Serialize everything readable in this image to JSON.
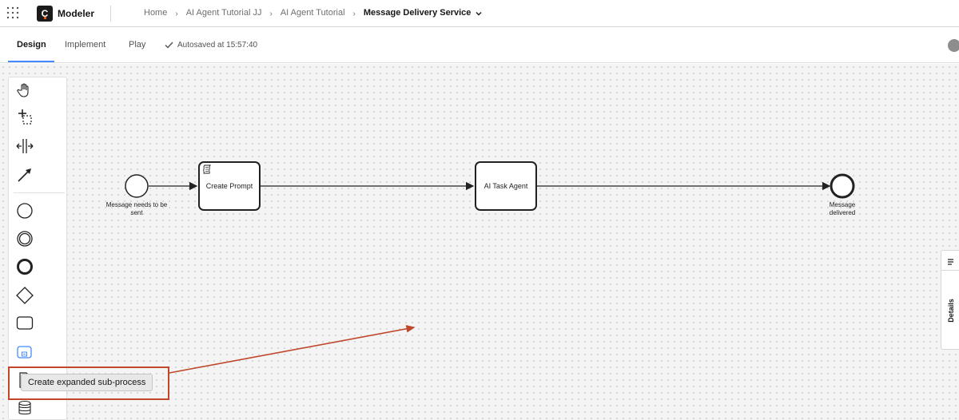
{
  "header": {
    "app_logo_letter": "C",
    "app_name": "Modeler",
    "breadcrumb": [
      "Home",
      "AI Agent Tutorial JJ",
      "AI Agent Tutorial"
    ],
    "breadcrumb_current": "Message Delivery Service"
  },
  "tabs": {
    "design": "Design",
    "implement": "Implement",
    "play": "Play",
    "autosave": "Autosaved at 15:57:40"
  },
  "diagram": {
    "start_event_label": "Message needs to be sent",
    "task1_label": "Create Prompt",
    "task2_label": "AI Task Agent",
    "end_event_label": "Message delivered"
  },
  "details_label": "Details",
  "tooltip": "Create expanded sub-process",
  "colors": {
    "accent": "#4589ff",
    "annotation": "#c0472a"
  }
}
